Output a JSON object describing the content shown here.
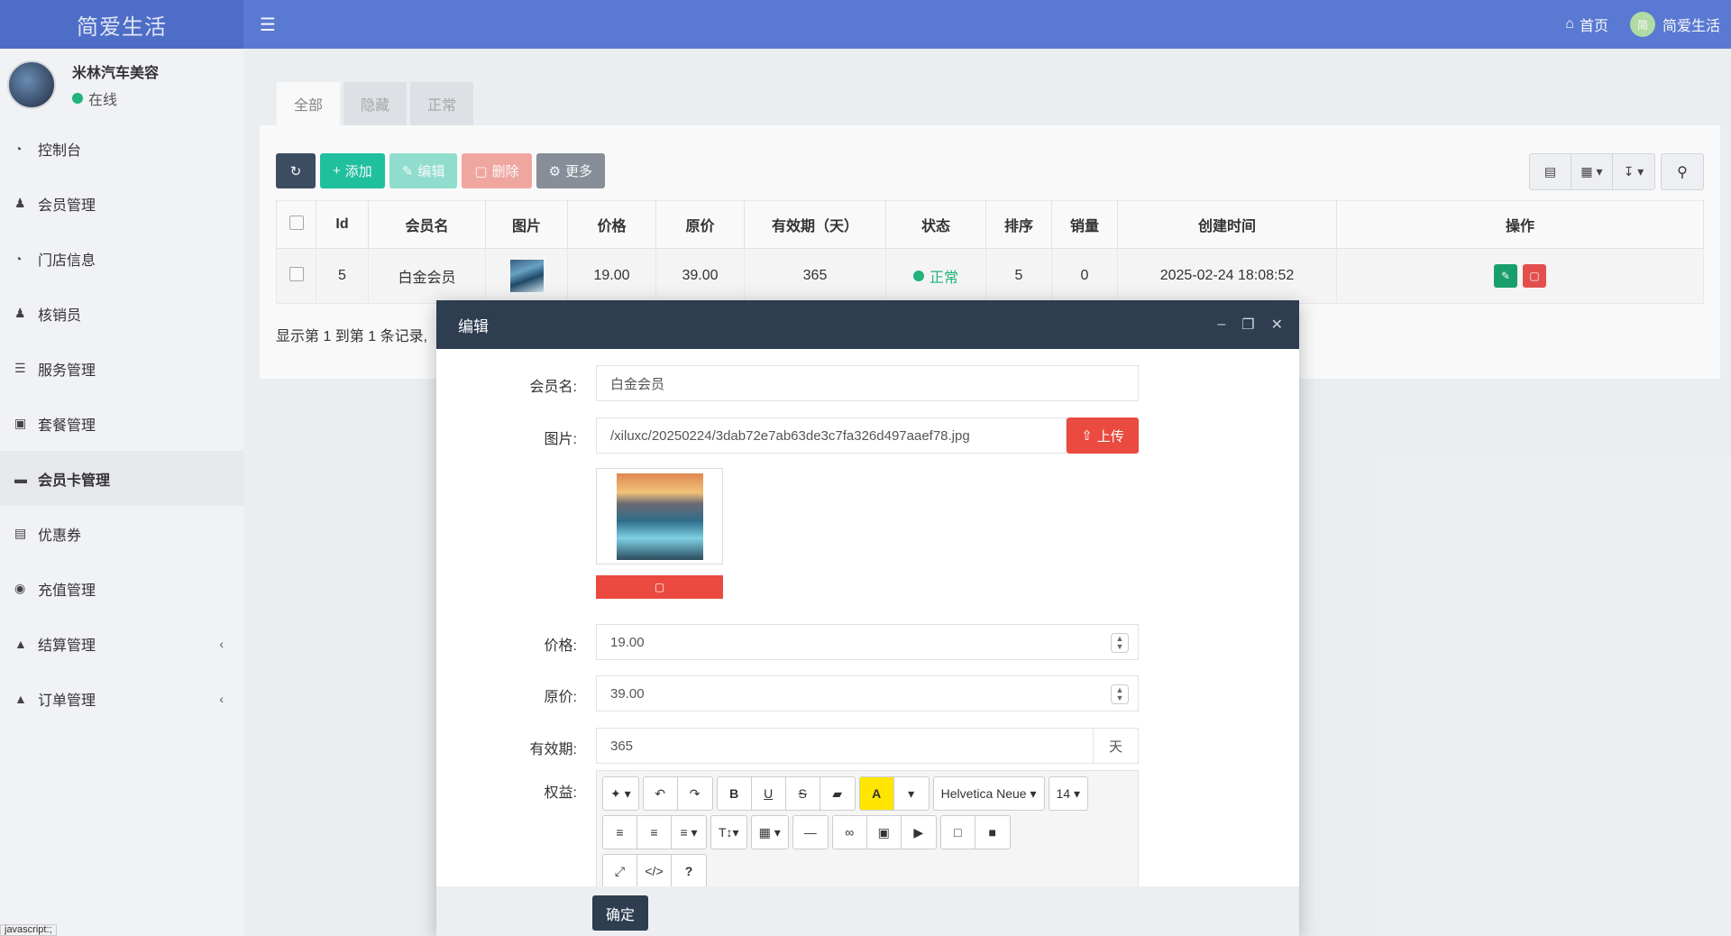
{
  "app": {
    "title": "简爱生活"
  },
  "header": {
    "home_label": "首页",
    "user_label": "简爱生活",
    "avatar_text": "简"
  },
  "profile": {
    "name": "米林汽车美容",
    "status": "在线"
  },
  "sidebar": {
    "items": [
      {
        "label": "控制台",
        "icon": "dashboard-icon"
      },
      {
        "label": "会员管理",
        "icon": "user-icon"
      },
      {
        "label": "门店信息",
        "icon": "dashboard-icon"
      },
      {
        "label": "核销员",
        "icon": "users-icon"
      },
      {
        "label": "服务管理",
        "icon": "server-icon"
      },
      {
        "label": "套餐管理",
        "icon": "gift-icon"
      },
      {
        "label": "会员卡管理",
        "icon": "credit-card-icon"
      },
      {
        "label": "优惠券",
        "icon": "id-card-icon"
      },
      {
        "label": "充值管理",
        "icon": "money-icon"
      },
      {
        "label": "结算管理",
        "icon": "shopping-bag-icon"
      },
      {
        "label": "订单管理",
        "icon": "shopping-bag-icon"
      }
    ]
  },
  "tabs": [
    "全部",
    "隐藏",
    "正常"
  ],
  "toolbar": {
    "add": "添加",
    "edit": "编辑",
    "delete": "删除",
    "more": "更多"
  },
  "table": {
    "columns": [
      "Id",
      "会员名",
      "图片",
      "价格",
      "原价",
      "有效期（天）",
      "状态",
      "排序",
      "销量",
      "创建时间",
      "操作"
    ],
    "rows": [
      {
        "id": "5",
        "name": "白金会员",
        "price": "19.00",
        "original": "39.00",
        "days": "365",
        "status": "正常",
        "sort": "5",
        "sales": "0",
        "created": "2025-02-24 18:08:52"
      }
    ],
    "summary": "显示第 1 到第 1 条记录,"
  },
  "modal": {
    "title": "编辑",
    "fields": {
      "name_label": "会员名:",
      "name_value": "白金会员",
      "image_label": "图片:",
      "image_value": "/xiluxc/20250224/3dab72e7ab63de3c7fa326d497aaef78.jpg",
      "upload": "上传",
      "price_label": "价格:",
      "price_value": "19.00",
      "original_label": "原价:",
      "original_value": "39.00",
      "validity_label": "有效期:",
      "validity_value": "365",
      "validity_unit": "天",
      "rights_label": "权益:"
    },
    "editor": {
      "font": "Helvetica Neue",
      "size": "14"
    },
    "confirm": "确定"
  },
  "statusbar": "javascript:;",
  "colors": {
    "header": "#5a7bd6",
    "logo": "#4e6fcb",
    "modal_header": "#2e3d50",
    "success": "#20b77a",
    "danger": "#ea4a3f",
    "primary_btn": "#1fc4a0"
  }
}
